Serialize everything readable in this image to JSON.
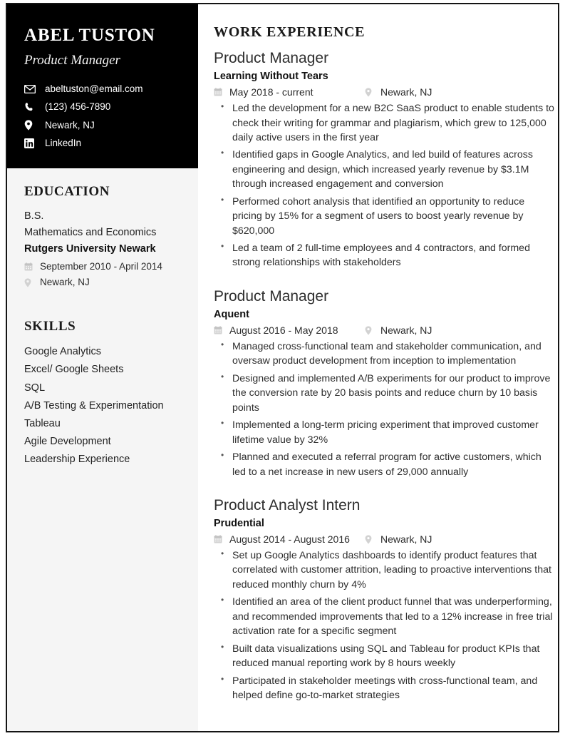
{
  "sidebar": {
    "name": "ABEL TUSTON",
    "title": "Product Manager",
    "contacts": [
      {
        "icon": "envelope-icon",
        "text": "abeltuston@email.com"
      },
      {
        "icon": "phone-icon",
        "text": "(123) 456-7890"
      },
      {
        "icon": "map-pin-icon",
        "text": "Newark, NJ"
      },
      {
        "icon": "linkedin-icon",
        "text": "LinkedIn"
      }
    ],
    "education": {
      "heading": "EDUCATION",
      "degree": "B.S.",
      "field": "Mathematics and Economics",
      "school": "Rutgers University Newark",
      "dates": "September 2010 - April 2014",
      "location": "Newark, NJ"
    },
    "skills": {
      "heading": "SKILLS",
      "items": [
        "Google Analytics",
        "Excel/ Google Sheets",
        "SQL",
        "A/B Testing & Experimentation",
        "Tableau",
        "Agile Development",
        "Leadership Experience"
      ]
    }
  },
  "main": {
    "heading": "WORK EXPERIENCE",
    "jobs": [
      {
        "role": "Product Manager",
        "company": "Learning Without Tears",
        "dates": "May 2018 - current",
        "location": "Newark, NJ",
        "bullets": [
          "Led the development for a new B2C SaaS product to enable students to check their writing for grammar and plagiarism, which grew to 125,000 daily active users in the first year",
          "Identified gaps in Google Analytics, and led build of features across engineering and design, which increased yearly revenue by $3.1M through increased engagement and conversion",
          "Performed cohort analysis that identified an opportunity to reduce pricing by 15% for a segment of users to boost yearly revenue by $620,000",
          "Led a team of 2 full-time employees and 4 contractors, and formed strong relationships with stakeholders"
        ]
      },
      {
        "role": "Product Manager",
        "company": "Aquent",
        "dates": "August 2016 - May 2018",
        "location": "Newark, NJ",
        "bullets": [
          "Managed cross-functional team and stakeholder communication, and oversaw product development from inception to implementation",
          "Designed and implemented A/B experiments for our product to improve the conversion rate by 20 basis points and reduce churn by 10 basis points",
          "Implemented a long-term pricing experiment that improved customer lifetime value by 32%",
          "Planned and executed a referral program for active customers, which led to a net increase in new users of 29,000 annually"
        ]
      },
      {
        "role": "Product Analyst Intern",
        "company": "Prudential",
        "dates": "August 2014 - August 2016",
        "location": "Newark, NJ",
        "bullets": [
          "Set up Google Analytics dashboards to identify product features that correlated with customer attrition, leading to proactive interventions that reduced monthly churn by 4%",
          "Identified an area of the client product funnel that was underperforming, and recommended improvements that led to a 12% increase in free trial activation rate for a specific segment",
          "Built data visualizations using SQL and Tableau for product KPIs that reduced manual reporting work by 8 hours weekly",
          "Participated in stakeholder meetings with cross-functional team, and helped define go-to-market strategies"
        ]
      }
    ]
  },
  "colors": {
    "header_background": "#000000",
    "sidebar_background": "#f5f5f5",
    "page_background": "#ffffff",
    "text_primary": "#2e2e2e",
    "meta_icon": "#cfcfcf"
  }
}
